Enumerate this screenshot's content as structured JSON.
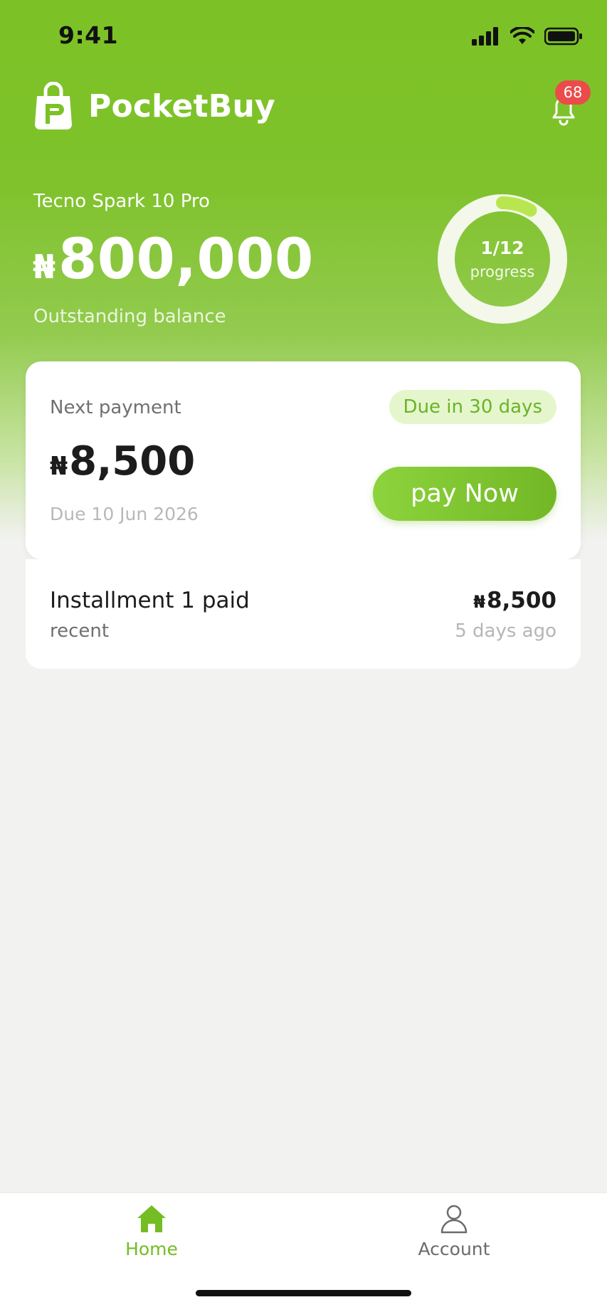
{
  "status_bar": {
    "time": "9:41"
  },
  "header": {
    "app_name": "PocketBuy",
    "notifications_count": "68",
    "icons": [
      "shopping-bag-logo-icon",
      "bell-icon"
    ]
  },
  "hero": {
    "device": "Tecno Spark 10 Pro",
    "currency_symbol": "₦",
    "balance": "800,000",
    "balance_label": "Outstanding balance",
    "progress": {
      "count": "1/12",
      "label": "progress",
      "paid": 1,
      "total": 12
    }
  },
  "next_payment": {
    "label": "Next payment",
    "due_pill": "Due in 30 days",
    "currency_symbol": "₦",
    "amount": "8,500",
    "due_date": "Due 10 Jun 2026",
    "pay_button": "pay Now"
  },
  "recent": {
    "title": "Installment 1 paid",
    "subtitle": "recent",
    "currency_symbol": "₦",
    "amount": "8,500",
    "time_ago": "5 days ago"
  },
  "tabs": [
    {
      "label": "Home",
      "icon": "home-icon",
      "active": true
    },
    {
      "label": "Account",
      "icon": "user-icon",
      "active": false
    }
  ],
  "colors": {
    "brand": "#7cc225",
    "accent_dark": "#72b826",
    "badge": "#ec4b4b",
    "pill_bg": "#e5f6cd"
  }
}
